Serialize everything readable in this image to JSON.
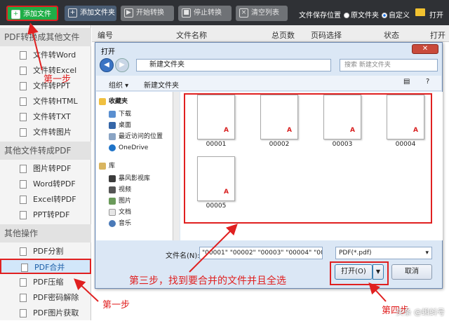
{
  "toolbar": {
    "add_file": "添加文件",
    "add_folder": "添加文件夹",
    "start": "开始转换",
    "stop": "停止转换",
    "clear": "清空列表",
    "save_location": "文件保存位置",
    "radio_origin": "原文件夹",
    "radio_custom": "自定义",
    "open_short": "打开"
  },
  "sidebar": {
    "sections": [
      "PDF转换成其他文件",
      "其他文件转成PDF",
      "其他操作"
    ],
    "group1": [
      "文件转Word",
      "文件转Excel",
      "文件转PPT",
      "文件转HTML",
      "文件转TXT",
      "文件转图片"
    ],
    "group2": [
      "图片转PDF",
      "Word转PDF",
      "Excel转PDF",
      "PPT转PDF"
    ],
    "group3": [
      "PDF分割",
      "PDF合并",
      "PDF压缩",
      "PDF密码解除",
      "PDF图片获取"
    ]
  },
  "table": {
    "headers": [
      "编号",
      "文件名称",
      "总页数",
      "页码选择",
      "状态",
      "打开"
    ]
  },
  "dialog": {
    "title": "打开",
    "path": "新建文件夹",
    "search_placeholder": "搜索 新建文件夹",
    "organize": "组织 ▾",
    "new_folder": "新建文件夹",
    "nav": {
      "favorites": "收藏夹",
      "fav_items": [
        "下载",
        "桌面",
        "最近访问的位置",
        "OneDrive"
      ],
      "library": "库",
      "lib_items": [
        "暴风影视库",
        "视频",
        "图片",
        "文档",
        "音乐"
      ]
    },
    "files": [
      "00001",
      "00002",
      "00003",
      "00004",
      "00005"
    ],
    "filename_label": "文件名(N):",
    "filename_value": "\"00001\" \"00002\" \"00003\" \"00004\" \"00005\"",
    "filetype": "PDF(*.pdf)",
    "open_button": "打开(O)",
    "cancel_button": "取消"
  },
  "annotations": {
    "step1_top": "第一步",
    "step1_bottom": "第一步",
    "step3": "第三步，找到要合并的文件并且全选",
    "step4": "第四步"
  },
  "watermark": "头条 @蝌蚪号"
}
